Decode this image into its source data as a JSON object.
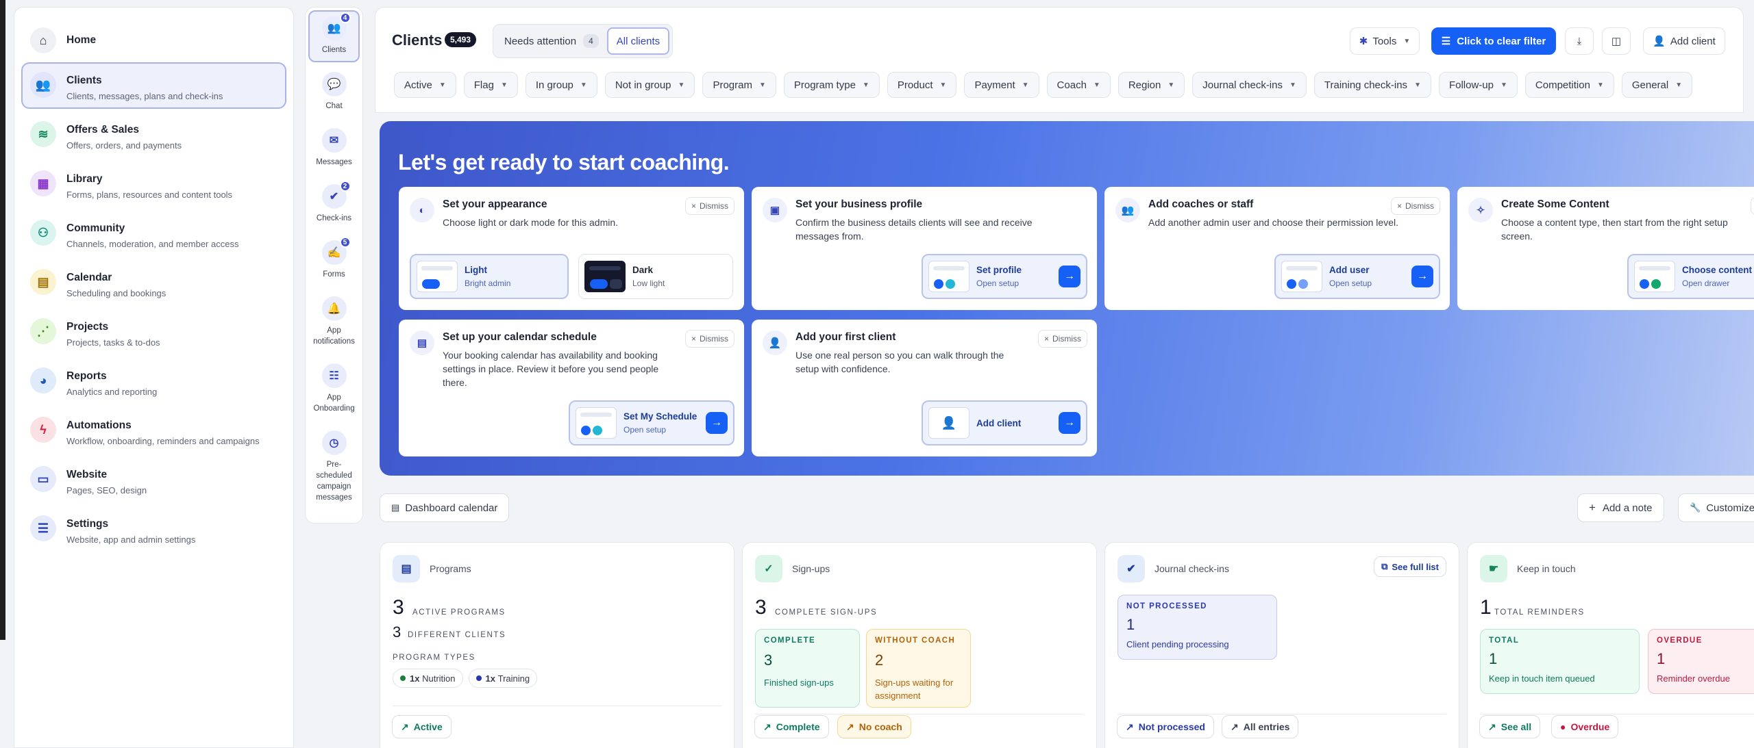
{
  "sidebar": {
    "items": [
      {
        "label": "Home",
        "desc": "",
        "icon": "home-icon"
      },
      {
        "label": "Clients",
        "desc": "Clients, messages, plans and check-ins",
        "icon": "users-icon"
      },
      {
        "label": "Offers & Sales",
        "desc": "Offers, orders, and payments",
        "icon": "layers-icon"
      },
      {
        "label": "Library",
        "desc": "Forms, plans, resources and content tools",
        "icon": "library-icon"
      },
      {
        "label": "Community",
        "desc": "Channels, moderation, and member access",
        "icon": "community-icon"
      },
      {
        "label": "Calendar",
        "desc": "Scheduling and bookings",
        "icon": "calendar-icon"
      },
      {
        "label": "Projects",
        "desc": "Projects, tasks & to-dos",
        "icon": "projects-icon"
      },
      {
        "label": "Reports",
        "desc": "Analytics and reporting",
        "icon": "pie-chart-icon"
      },
      {
        "label": "Automations",
        "desc": "Workflow, onboarding, reminders and campaigns",
        "icon": "lightning-icon"
      },
      {
        "label": "Website",
        "desc": "Pages, SEO, design",
        "icon": "laptop-icon"
      },
      {
        "label": "Settings",
        "desc": "Website, app and admin settings",
        "icon": "sliders-icon"
      }
    ]
  },
  "rail": {
    "items": [
      {
        "label": "Clients",
        "badge": "4"
      },
      {
        "label": "Chat",
        "badge": ""
      },
      {
        "label": "Messages",
        "badge": ""
      },
      {
        "label": "Check-ins",
        "badge": "2"
      },
      {
        "label": "Forms",
        "badge": "5"
      },
      {
        "label": "App notifications",
        "badge": ""
      },
      {
        "label": "App Onboarding",
        "badge": ""
      },
      {
        "label": "Pre-scheduled campaign messages",
        "badge": ""
      }
    ]
  },
  "header": {
    "title": "Clients",
    "count": "5,493",
    "needs_attention": "Needs attention",
    "needs_attention_count": "4",
    "all_clients": "All clients",
    "tools": "Tools",
    "clear_filter": "Click to clear filter",
    "add_client": "Add client",
    "filters": [
      "Active",
      "Flag",
      "In group",
      "Not in group",
      "Program",
      "Program type",
      "Product",
      "Payment",
      "Coach",
      "Region",
      "Journal check-ins",
      "Training check-ins",
      "Follow-up",
      "Competition",
      "General"
    ]
  },
  "hero": {
    "title": "Let's get ready to start coaching.",
    "dismiss": "Dismiss",
    "cards": {
      "appearance": {
        "title": "Set your appearance",
        "desc": "Choose light or dark mode for this admin.",
        "light_label": "Light",
        "light_sub": "Bright admin",
        "dark_label": "Dark",
        "dark_sub": "Low light"
      },
      "business": {
        "title": "Set your business profile",
        "desc": "Confirm the business details clients will see and receive messages from.",
        "action": "Set profile",
        "action_sub": "Open setup"
      },
      "coaches": {
        "title": "Add coaches or staff",
        "desc": "Add another admin user and choose their permission level.",
        "action": "Add user",
        "action_sub": "Open setup"
      },
      "content": {
        "title": "Create Some Content",
        "desc": "Choose a content type, then start from the right setup screen.",
        "action": "Choose content",
        "action_sub": "Open drawer"
      },
      "calendar": {
        "title": "Set up your calendar schedule",
        "desc": "Your booking calendar has availability and booking settings in place. Review it before you send people there.",
        "action": "Set My Schedule",
        "action_sub": "Open setup"
      },
      "first_client": {
        "title": "Add your first client",
        "desc": "Use one real person so you can walk through the setup with confidence.",
        "action": "Add client"
      }
    }
  },
  "toolbar": {
    "dashboard_calendar": "Dashboard calendar",
    "add_note": "Add a note",
    "customize": "Customize"
  },
  "widgets": {
    "programs": {
      "title": "Programs",
      "active_count": "3",
      "active_label": "ACTIVE PROGRAMS",
      "clients_count": "3",
      "clients_label": "DIFFERENT CLIENTS",
      "types_label": "PROGRAM TYPES",
      "types": [
        {
          "count": "1x",
          "name": "Nutrition",
          "color": "#1a7f37"
        },
        {
          "count": "1x",
          "name": "Training",
          "color": "#2336b8"
        }
      ],
      "button": "Active"
    },
    "signups": {
      "title": "Sign-ups",
      "count": "3",
      "label": "COMPLETE SIGN-UPS",
      "complete_cap": "COMPLETE",
      "complete_num": "3",
      "complete_desc": "Finished sign-ups",
      "nocoach_cap": "WITHOUT COACH",
      "nocoach_num": "2",
      "nocoach_desc": "Sign-ups waiting for assignment",
      "btn_complete": "Complete",
      "btn_nocoach": "No coach"
    },
    "journal": {
      "title": "Journal check-ins",
      "see_full": "See full list",
      "cap": "NOT PROCESSED",
      "num": "1",
      "desc": "Client pending processing",
      "btn_np": "Not processed",
      "btn_all": "All entries"
    },
    "keep": {
      "title": "Keep in touch",
      "count": "1",
      "label": "TOTAL REMINDERS",
      "total_cap": "TOTAL",
      "total_num": "1",
      "total_desc": "Keep in touch item queued",
      "overdue_cap": "OVERDUE",
      "overdue_num": "1",
      "overdue_desc": "Reminder overdue",
      "btn_see_all": "See all",
      "btn_overdue": "Overdue"
    }
  }
}
